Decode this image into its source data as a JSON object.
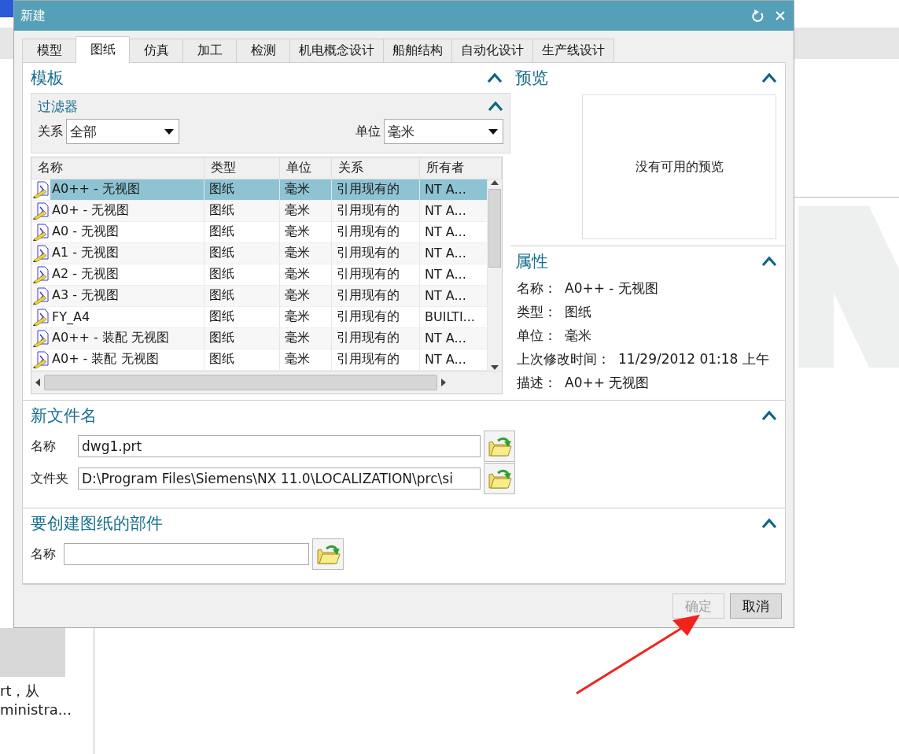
{
  "window": {
    "title": "新建"
  },
  "tabs": [
    {
      "label": "模型",
      "selected": false
    },
    {
      "label": "图纸",
      "selected": true
    },
    {
      "label": "仿真",
      "selected": false
    },
    {
      "label": "加工",
      "selected": false
    },
    {
      "label": "检测",
      "selected": false
    },
    {
      "label": "机电概念设计",
      "selected": false
    },
    {
      "label": "船舶结构",
      "selected": false
    },
    {
      "label": "自动化设计",
      "selected": false
    },
    {
      "label": "生产线设计",
      "selected": false
    }
  ],
  "template": {
    "title": "模板",
    "filter": {
      "title": "过滤器",
      "relation": {
        "label": "关系",
        "value": "全部"
      },
      "unit": {
        "label": "单位",
        "value": "毫米"
      }
    },
    "table": {
      "columns": [
        "名称",
        "类型",
        "单位",
        "关系",
        "所有者"
      ],
      "rows": [
        {
          "cells": [
            "A0++ - 无视图",
            "图纸",
            "毫米",
            "引用现有的",
            "NT A..."
          ],
          "selected": true
        },
        {
          "cells": [
            "A0+ - 无视图",
            "图纸",
            "毫米",
            "引用现有的",
            "NT A..."
          ],
          "selected": false
        },
        {
          "cells": [
            "A0 - 无视图",
            "图纸",
            "毫米",
            "引用现有的",
            "NT A..."
          ],
          "selected": false
        },
        {
          "cells": [
            "A1 - 无视图",
            "图纸",
            "毫米",
            "引用现有的",
            "NT A..."
          ],
          "selected": false
        },
        {
          "cells": [
            "A2 - 无视图",
            "图纸",
            "毫米",
            "引用现有的",
            "NT A..."
          ],
          "selected": false
        },
        {
          "cells": [
            "A3 - 无视图",
            "图纸",
            "毫米",
            "引用现有的",
            "NT A..."
          ],
          "selected": false
        },
        {
          "cells": [
            "FY_A4",
            "图纸",
            "毫米",
            "引用现有的",
            "BUILTI..."
          ],
          "selected": false
        },
        {
          "cells": [
            "A0++ - 装配 无视图",
            "图纸",
            "毫米",
            "引用现有的",
            "NT A..."
          ],
          "selected": false
        },
        {
          "cells": [
            "A0+ - 装配 无视图",
            "图纸",
            "毫米",
            "引用现有的",
            "NT A..."
          ],
          "selected": false
        }
      ]
    }
  },
  "preview": {
    "title": "预览",
    "message": "没有可用的预览"
  },
  "properties": {
    "title": "属性",
    "items": [
      {
        "label": "名称：",
        "value": "A0++ - 无视图"
      },
      {
        "label": "类型：",
        "value": "图纸"
      },
      {
        "label": "单位：",
        "value": "毫米"
      },
      {
        "label": "上次修改时间：",
        "value": "11/29/2012 01:18 上午"
      },
      {
        "label": "描述：",
        "value": "A0++ 无视图"
      }
    ]
  },
  "new_file": {
    "title": "新文件名",
    "fields": [
      {
        "label": "名称",
        "value": "dwg1.prt"
      },
      {
        "label": "文件夹",
        "value": "D:\\Program Files\\Siemens\\NX 11.0\\LOCALIZATION\\prc\\si"
      }
    ]
  },
  "part": {
    "title": "要创建图纸的部件",
    "fields": [
      {
        "label": "名称"
      }
    ]
  },
  "buttons": [
    {
      "label": "确定",
      "disabled": true
    },
    {
      "label": "取消",
      "disabled": false
    }
  ],
  "background": {
    "texts": [
      "rt，从",
      "ministra..."
    ]
  }
}
